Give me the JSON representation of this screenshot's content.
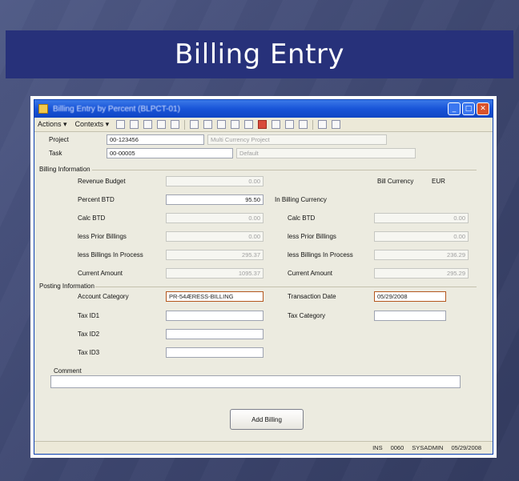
{
  "slide": {
    "title": "Billing Entry"
  },
  "window": {
    "title": "Billing Entry by Percent (BLPCT-01)"
  },
  "toolbar": {
    "actions_menu": "Actions ▾",
    "contexts_menu": "Contexts ▾"
  },
  "header": {
    "project_label": "Project",
    "project_id": "00-123456",
    "project_name": "Multi Currency Project",
    "task_label": "Task",
    "task_id": "00-00005",
    "task_name": "Default"
  },
  "billing_info": {
    "section_label": "Billing Information",
    "revenue_budget_label": "Revenue Budget",
    "revenue_budget": "0.00",
    "percent_btd_label": "Percent BTD",
    "percent_btd": "95.50",
    "calc_btd_label": "Calc BTD",
    "calc_btd": "0.00",
    "less_prior_label": "less Prior Billings",
    "less_prior": "0.00",
    "less_in_process_label": "less Billings In Process",
    "less_in_process": "295.37",
    "current_amount_label": "Current Amount",
    "current_amount": "1095.37",
    "bill_currency_label": "Bill Currency",
    "bill_currency": "EUR",
    "in_billing_currency_label": "In Billing Currency",
    "bc_calc_btd_label": "Calc BTD",
    "bc_calc_btd": "0.00",
    "bc_less_prior_label": "less Prior Billings",
    "bc_less_prior": "0.00",
    "bc_less_in_process_label": "less Billings In Process",
    "bc_less_in_process": "236.29",
    "bc_current_amount_label": "Current Amount",
    "bc_current_amount": "295.29"
  },
  "posting_info": {
    "section_label": "Posting Information",
    "account_category_label": "Account Category",
    "account_category": "PR-54ÆRESS-BILLING",
    "transaction_date_label": "Transaction Date",
    "transaction_date": "05/29/2008",
    "tax_id1_label": "Tax ID1",
    "tax_id1": "",
    "tax_id2_label": "Tax ID2",
    "tax_id2": "",
    "tax_id3_label": "Tax ID3",
    "tax_id3": "",
    "tax_category_label": "Tax Category",
    "tax_category": ""
  },
  "comment": {
    "label": "Comment",
    "value": ""
  },
  "actions": {
    "add_billing": "Add Billing"
  },
  "status": {
    "mode": "INS",
    "company": "0060",
    "user": "SYSADMIN",
    "date": "05/29/2008"
  },
  "colors": {
    "title_band": "#27317a",
    "titlebar": "#1854d8",
    "window_bg": "#ecebe0",
    "required_border": "#b4571e"
  }
}
